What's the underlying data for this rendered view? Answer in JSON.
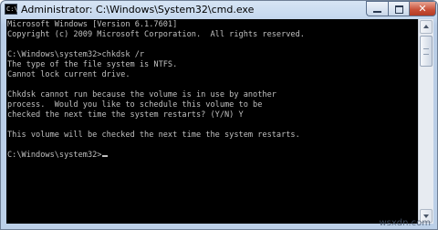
{
  "window": {
    "title": "Administrator: C:\\Windows\\System32\\cmd.exe",
    "icon_label": "C:\\",
    "close_glyph": "✕"
  },
  "console": {
    "lines": [
      "Microsoft Windows [Version 6.1.7601]",
      "Copyright (c) 2009 Microsoft Corporation.  All rights reserved.",
      "",
      "C:\\Windows\\system32>chkdsk /r",
      "The type of the file system is NTFS.",
      "Cannot lock current drive.",
      "",
      "Chkdsk cannot run because the volume is in use by another",
      "process.  Would you like to schedule this volume to be",
      "checked the next time the system restarts? (Y/N) Y",
      "",
      "This volume will be checked the next time the system restarts.",
      "",
      "C:\\Windows\\system32>"
    ]
  },
  "watermark": "wsxdn.com",
  "colors": {
    "console_bg": "#000000",
    "console_text": "#c0c0c0",
    "close_button": "#c74d35"
  }
}
